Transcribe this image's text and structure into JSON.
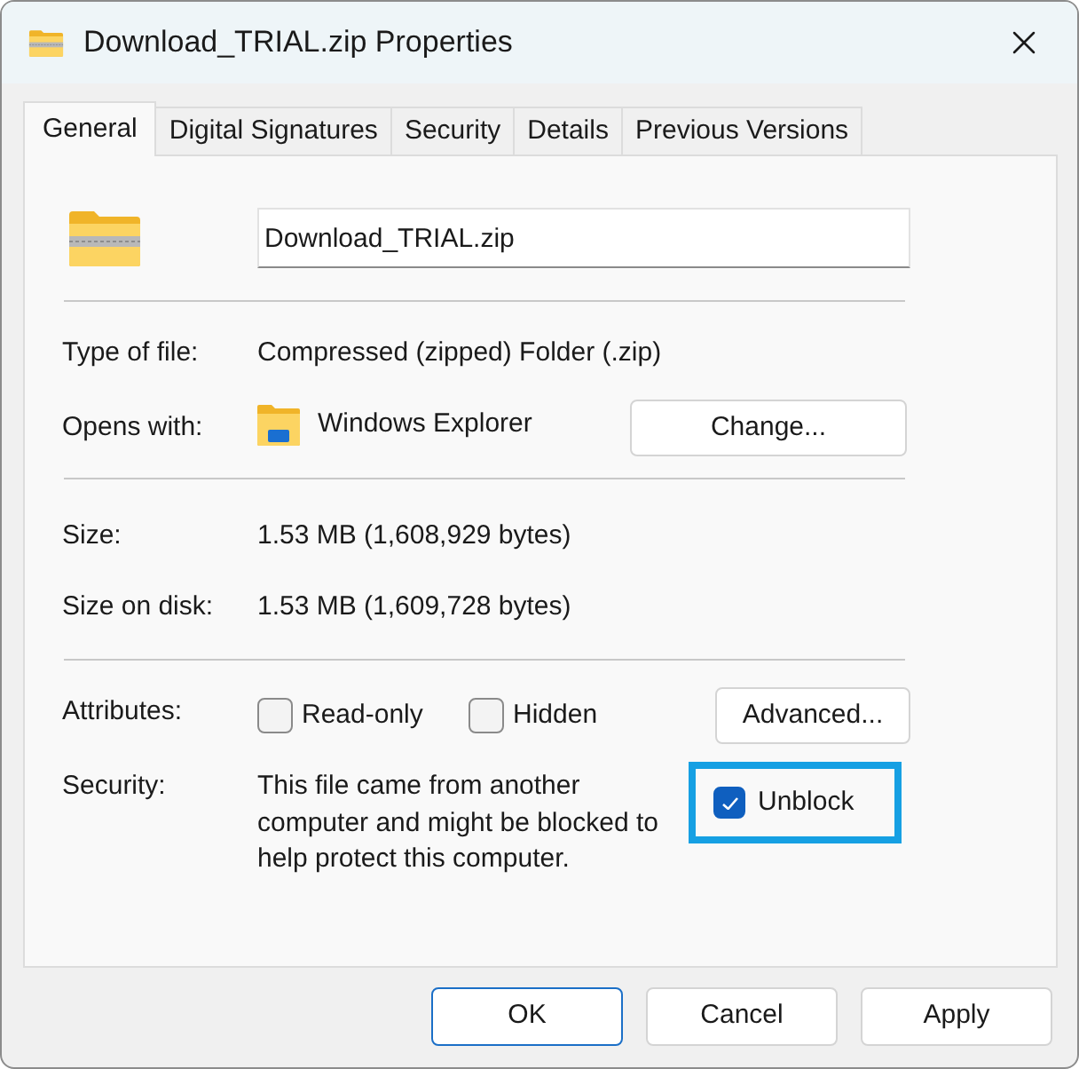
{
  "window": {
    "title": "Download_TRIAL.zip Properties"
  },
  "tabs": [
    {
      "label": "General",
      "selected": true
    },
    {
      "label": "Digital Signatures",
      "selected": false
    },
    {
      "label": "Security",
      "selected": false
    },
    {
      "label": "Details",
      "selected": false
    },
    {
      "label": "Previous Versions",
      "selected": false
    }
  ],
  "file_name": {
    "value": "Download_TRIAL.zip"
  },
  "type_of_file": {
    "label": "Type of file:",
    "value": "Compressed (zipped) Folder (.zip)"
  },
  "opens_with": {
    "label": "Opens with:",
    "value": "Windows Explorer",
    "button": "Change..."
  },
  "size": {
    "label": "Size:",
    "value": "1.53 MB (1,608,929 bytes)"
  },
  "size_on_disk": {
    "label": "Size on disk:",
    "value": "1.53 MB (1,609,728 bytes)"
  },
  "attributes": {
    "label": "Attributes:",
    "options": [
      {
        "label": "Read-only",
        "checked": false
      },
      {
        "label": "Hidden",
        "checked": false
      }
    ],
    "button": "Advanced..."
  },
  "security": {
    "label": "Security:",
    "text": "This file came from another computer and might be blocked to help protect this computer.",
    "unblock": {
      "label": "Unblock",
      "checked": true,
      "highlighted": true
    }
  },
  "buttons": [
    {
      "label": "OK",
      "default": true
    },
    {
      "label": "Cancel",
      "default": false
    },
    {
      "label": "Apply",
      "default": false
    }
  ]
}
